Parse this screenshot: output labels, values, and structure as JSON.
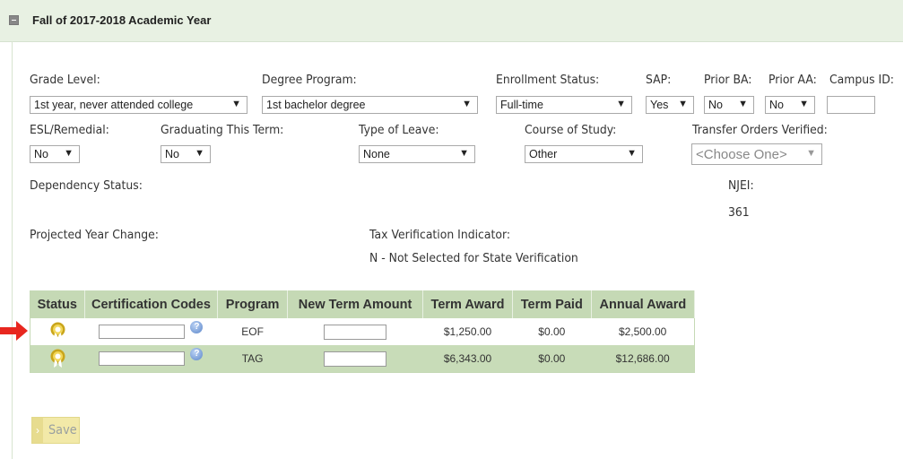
{
  "header": {
    "title": "Fall of 2017-2018 Academic Year"
  },
  "form": {
    "grade_level": {
      "label": "Grade Level:",
      "value": "1st year, never attended college"
    },
    "degree_program": {
      "label": "Degree Program:",
      "value": "1st bachelor degree"
    },
    "enrollment_status": {
      "label": "Enrollment Status:",
      "value": "Full-time"
    },
    "sap": {
      "label": "SAP:",
      "value": "Yes"
    },
    "prior_ba": {
      "label": "Prior BA:",
      "value": "No"
    },
    "prior_aa": {
      "label": "Prior AA:",
      "value": "No"
    },
    "campus_id": {
      "label": "Campus ID:",
      "value": ""
    },
    "esl_remedial": {
      "label": "ESL/Remedial:",
      "value": "No"
    },
    "graduating_this_term": {
      "label": "Graduating This Term:",
      "value": "No"
    },
    "type_of_leave": {
      "label": "Type of Leave:",
      "value": "None"
    },
    "course_of_study": {
      "label": "Course of Study:",
      "value": "Other"
    },
    "transfer_orders_verified": {
      "label": "Transfer Orders Verified:",
      "value": "<Choose One>"
    },
    "dependency_status": {
      "label": "Dependency Status:",
      "value": ""
    },
    "njei": {
      "label": "NJEI:",
      "value": "361"
    },
    "projected_year_change": {
      "label": "Projected Year Change:",
      "value": ""
    },
    "tax_verification_indicator": {
      "label": "Tax Verification Indicator:",
      "value": "N - Not Selected for State Verification"
    }
  },
  "table": {
    "headers": [
      "Status",
      "Certification Codes",
      "Program",
      "New Term Amount",
      "Term Award",
      "Term Paid",
      "Annual Award"
    ],
    "rows": [
      {
        "program": "EOF",
        "term_award": "$1,250.00",
        "term_paid": "$0.00",
        "annual_award": "$2,500.00"
      },
      {
        "program": "TAG",
        "term_award": "$6,343.00",
        "term_paid": "$0.00",
        "annual_award": "$12,686.00"
      }
    ]
  },
  "actions": {
    "save_label": "Save"
  },
  "colors": {
    "header_bg": "#e8f1e3",
    "table_header_bg": "#c5d9b5",
    "alt_row_bg": "#c8dcb8",
    "marker_red": "#e8271f",
    "save_bg": "#f2e9a8"
  }
}
